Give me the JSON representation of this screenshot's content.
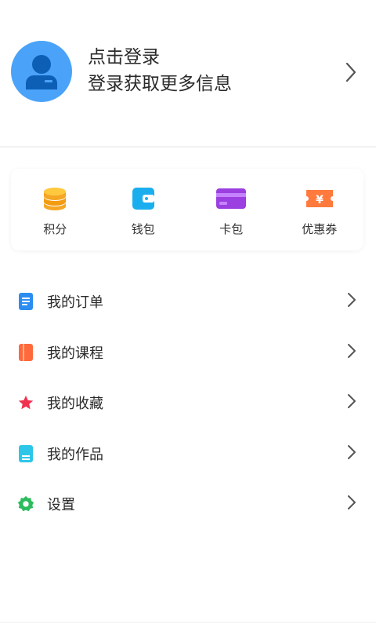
{
  "profile": {
    "title": "点击登录",
    "subtitle": "登录获取更多信息",
    "avatar_icon": "user-avatar-icon",
    "avatar_color": "#4aa3f8"
  },
  "shortcuts": [
    {
      "label": "积分",
      "icon": "coins-icon",
      "color": "#f5a623"
    },
    {
      "label": "钱包",
      "icon": "wallet-icon",
      "color": "#1aaeee"
    },
    {
      "label": "卡包",
      "icon": "card-icon",
      "color": "#9b3fe0"
    },
    {
      "label": "优惠券",
      "icon": "coupon-icon",
      "color": "#ff7a3c"
    }
  ],
  "menu": [
    {
      "label": "我的订单",
      "icon": "order-icon",
      "color": "#2b8df0"
    },
    {
      "label": "我的课程",
      "icon": "course-icon",
      "color": "#ff6a3d"
    },
    {
      "label": "我的收藏",
      "icon": "star-icon",
      "color": "#f0314f"
    },
    {
      "label": "我的作品",
      "icon": "works-icon",
      "color": "#2ec6e8"
    },
    {
      "label": "设置",
      "icon": "gear-icon",
      "color": "#2dbb5d"
    }
  ]
}
